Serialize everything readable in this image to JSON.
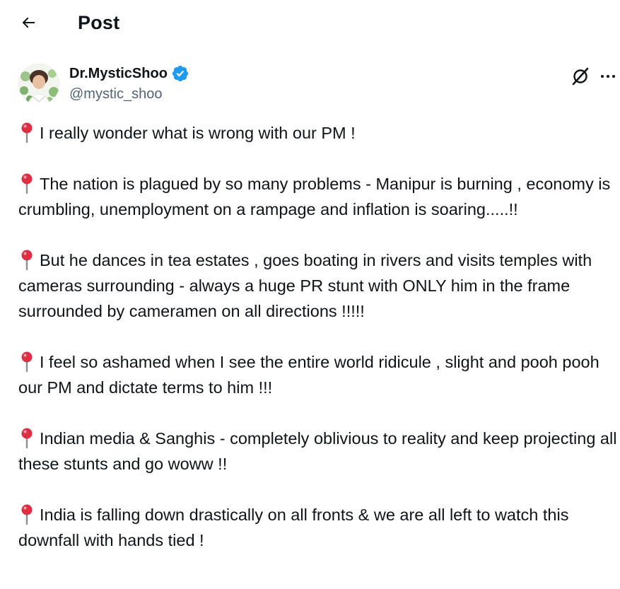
{
  "header": {
    "back_icon": "arrow-left-icon",
    "title": "Post"
  },
  "author": {
    "display_name": "Dr.MysticShoo",
    "handle": "@mystic_shoo",
    "verified": true,
    "verified_color": "#1d9bf0"
  },
  "actions": {
    "grok_icon": "grok-icon",
    "more_icon": "more-horizontal-icon"
  },
  "post": {
    "bullet_icon": "round-pushpin-emoji",
    "paragraphs": [
      "I really wonder what is wrong with our PM !",
      "The nation is plagued by so many problems - Manipur is burning , economy is crumbling, unemployment on a rampage and inflation is soaring.....!!",
      "But he dances in tea estates , goes boating in rivers and visits temples with cameras surrounding - always a huge PR stunt with ONLY him in the frame surrounded by cameramen on all directions !!!!!",
      "I feel so ashamed when I see the entire world ridicule , slight and pooh pooh our PM and dictate terms to him !!!",
      "Indian media & Sanghis - completely oblivious to reality and keep projecting all these stunts and go woww !!",
      "India is falling down drastically on all fronts  & we are all left to watch this downfall with hands tied !"
    ]
  },
  "colors": {
    "text_primary": "#0f1419",
    "text_secondary": "#536471",
    "pin_red": "#dd2e44"
  }
}
